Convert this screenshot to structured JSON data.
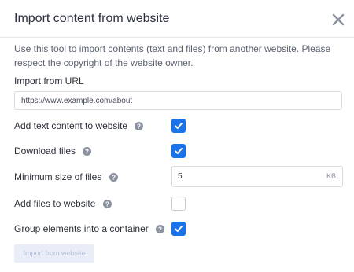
{
  "dialog": {
    "title": "Import content from website",
    "description": "Use this tool to import contents (text and files) from another website. Please respect the copyright of the website owner."
  },
  "url": {
    "label": "Import from URL",
    "placeholder": "https://www.example.com/about"
  },
  "options": {
    "add_text": {
      "label": "Add text content to website",
      "checked": true
    },
    "download_files": {
      "label": "Download files",
      "checked": true
    },
    "min_size": {
      "label": "Minimum size of files",
      "value": "5",
      "unit": "KB"
    },
    "add_files": {
      "label": "Add files to website",
      "checked": false
    },
    "group": {
      "label": "Group elements into a container",
      "checked": true
    }
  },
  "actions": {
    "import_label": "Import from website"
  },
  "colors": {
    "accent": "#1a73e8",
    "disabled_button_bg": "#e8edf8",
    "help_icon": "#8a909e"
  },
  "icons": {
    "close": "close-icon",
    "help": "help-icon",
    "check": "check-icon"
  }
}
